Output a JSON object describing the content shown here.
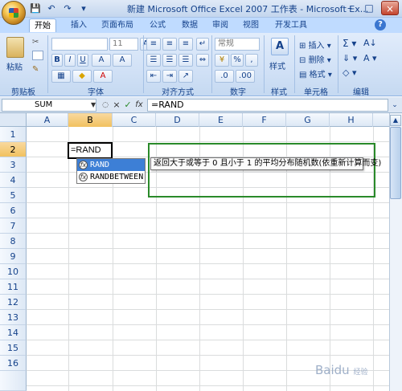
{
  "window": {
    "title": "新建 Microsoft Office Excel 2007 工作表 - Microsoft Ex...",
    "controls": [
      "–",
      "□",
      "×"
    ]
  },
  "quick_access": [
    "💾",
    "↶",
    "↷",
    "▾"
  ],
  "ribbon": {
    "tabs": [
      "开始",
      "插入",
      "页面布局",
      "公式",
      "数据",
      "审阅",
      "视图",
      "开发工具"
    ],
    "active_tab": "开始",
    "groups": [
      "剪贴板",
      "字体",
      "对齐方式",
      "数字",
      "样式",
      "单元格",
      "编辑"
    ],
    "clipboard": {
      "paste": "粘贴"
    },
    "font": {
      "size": "11",
      "bold": "B",
      "italic": "I",
      "underline": "U"
    },
    "number": {
      "format": "常规",
      "percent": "%",
      "comma": ","
    },
    "styles": {
      "label": "样式"
    },
    "cells": {
      "insert": "插入",
      "delete": "删除",
      "format": "格式"
    },
    "editing": {
      "sum": "Σ",
      "sort": "A↓",
      "find": "A"
    }
  },
  "formula_bar": {
    "name_box": "SUM",
    "cancel": "×",
    "enter": "✓",
    "fx": "fx",
    "value": "=RAND"
  },
  "grid": {
    "columns": [
      "A",
      "B",
      "C",
      "D",
      "E",
      "F",
      "G",
      "H"
    ],
    "rows": [
      "1",
      "2",
      "3",
      "4",
      "5",
      "6",
      "7",
      "8",
      "9",
      "10",
      "11",
      "12",
      "13",
      "14",
      "15",
      "16"
    ],
    "active_cell_text": "=RAND"
  },
  "autocomplete": {
    "items": [
      "RAND",
      "RANDBETWEEN"
    ],
    "tooltip": "返回大于或等于 0 且小于 1 的平均分布随机数(依重新计算而变)"
  },
  "watermark": {
    "text": "Baidu",
    "sub": "经验"
  },
  "colors": {
    "ribbon_tab_bg": "#bfdbff",
    "selection": "#3d7fd6",
    "annotation": "#2a8a2a"
  }
}
